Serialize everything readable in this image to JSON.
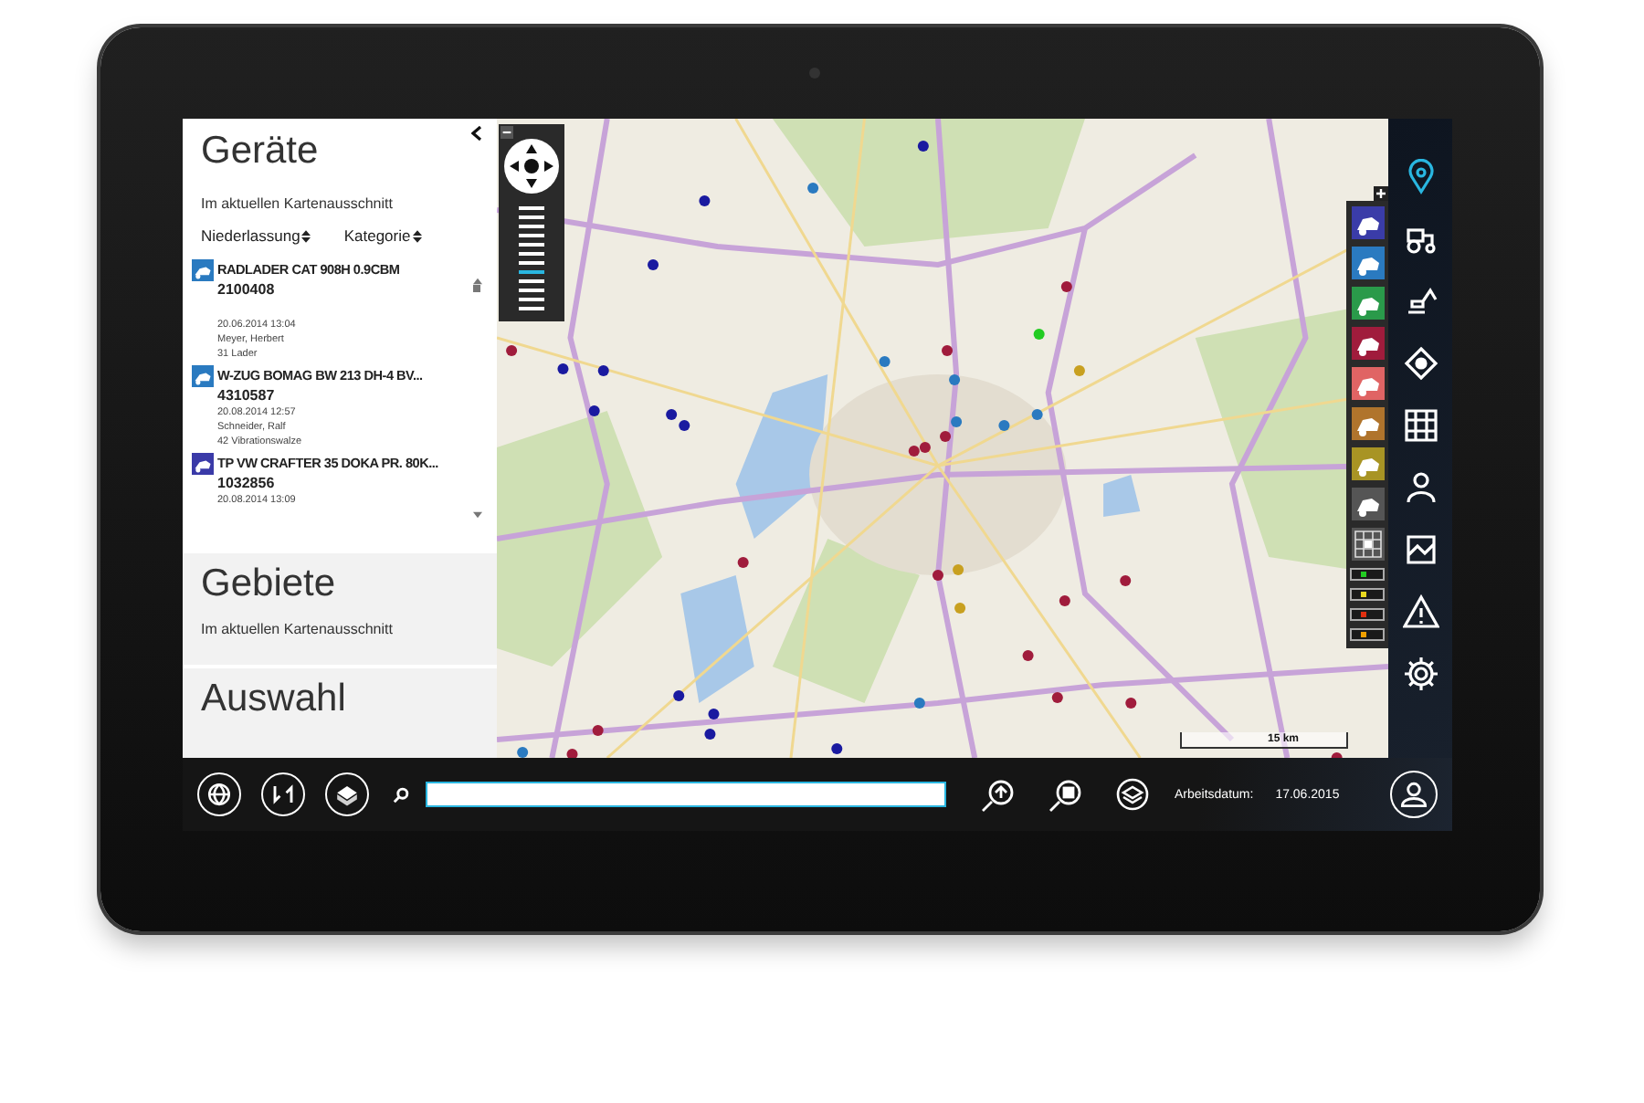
{
  "devices": {
    "title": "Geräte",
    "subtitle": "Im aktuellen Kartenausschnitt",
    "sort": [
      "Niederlassung",
      "Kategorie"
    ],
    "items": [
      {
        "name": "RADLADER CAT 908H 0.9CBM",
        "number": "2100408",
        "date": "20.06.2014 13:04",
        "person": "Meyer, Herbert",
        "category": "31 Lader",
        "color": "#2a7ac0"
      },
      {
        "name": "W-ZUG BOMAG BW 213 DH-4 BV...",
        "number": "4310587",
        "date": "20.08.2014 12:57",
        "person": "Schneider, Ralf",
        "category": "42 Vibrationswalze",
        "color": "#2a7ac0"
      },
      {
        "name": "TP VW CRAFTER 35 DOKA PR. 80K...",
        "number": "1032856",
        "date": "20.08.2014 13:09",
        "color": "#3a3aa8"
      }
    ]
  },
  "areas": {
    "title": "Gebiete",
    "subtitle": "Im aktuellen Kartenausschnitt"
  },
  "selection": {
    "title": "Auswahl"
  },
  "map": {
    "zoom": {
      "level": 0.35
    },
    "scale_label": "15 km",
    "layers": [
      {
        "kind": "tile",
        "color": "#3a3ca8"
      },
      {
        "kind": "tile",
        "color": "#2a7ac0"
      },
      {
        "kind": "tile",
        "color": "#2a9a4a"
      },
      {
        "kind": "tile",
        "color": "#a01c3c"
      },
      {
        "kind": "tile",
        "color": "#e06464"
      },
      {
        "kind": "tile",
        "color": "#b0742c"
      },
      {
        "kind": "tile",
        "color": "#a89424"
      },
      {
        "kind": "tile",
        "color": "#555555"
      },
      {
        "kind": "grid",
        "color": "#555555"
      },
      {
        "kind": "status",
        "color": "#22cc22"
      },
      {
        "kind": "status",
        "color": "#e8d820"
      },
      {
        "kind": "status",
        "color": "#e03010"
      },
      {
        "kind": "status",
        "color": "#f0a000"
      }
    ]
  },
  "sidebar": [
    {
      "kind": "pin",
      "selected": true
    },
    {
      "kind": "tractor",
      "selected": false
    },
    {
      "kind": "excavator",
      "selected": false
    },
    {
      "kind": "target",
      "selected": false
    },
    {
      "kind": "grid",
      "selected": false
    },
    {
      "kind": "person",
      "selected": false
    },
    {
      "kind": "image",
      "selected": false
    },
    {
      "kind": "warning",
      "selected": false
    },
    {
      "kind": "gear",
      "selected": false
    }
  ],
  "toolbar": {
    "date_label": "Arbeitsdatum:",
    "date": "17.06.2015"
  }
}
